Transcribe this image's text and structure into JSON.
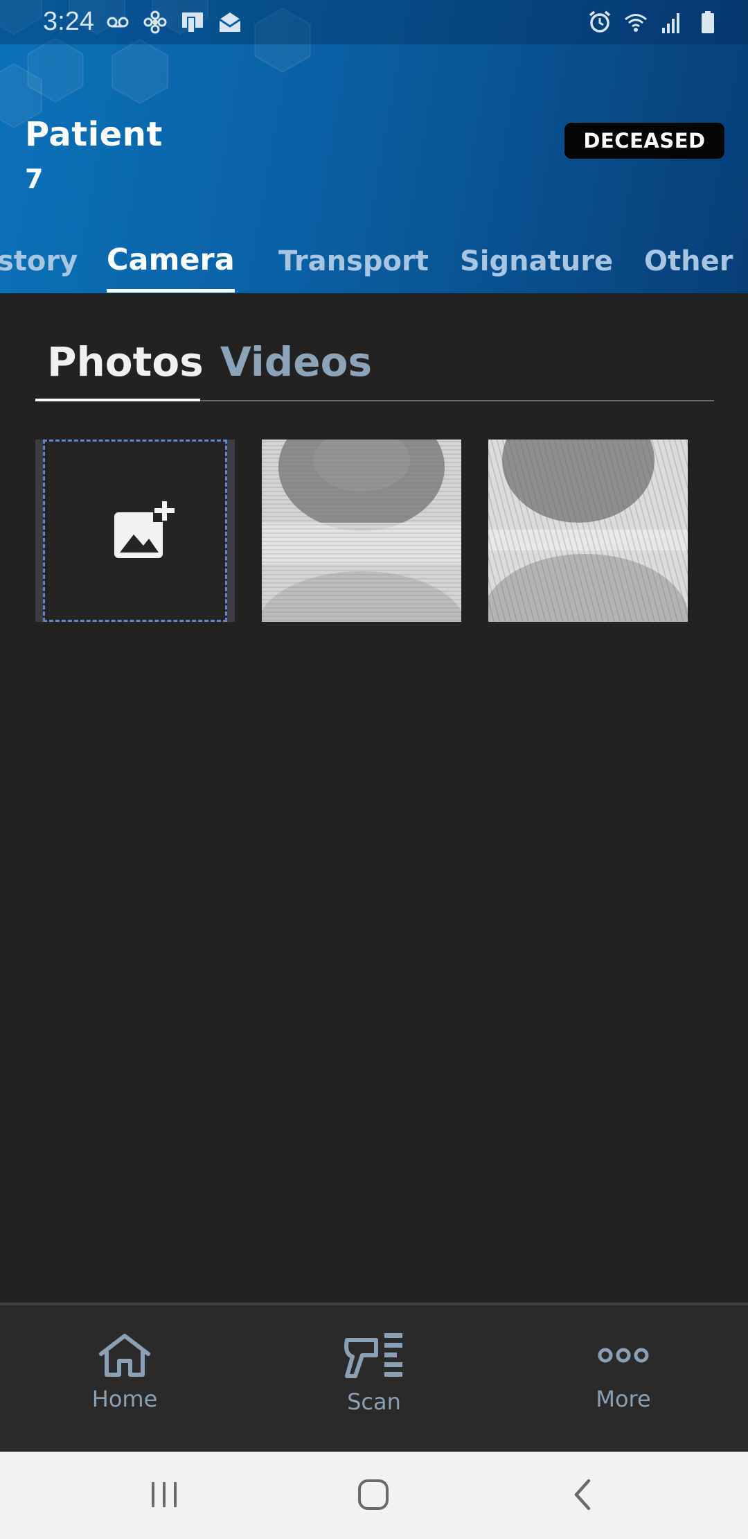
{
  "status_bar": {
    "time": "3:24"
  },
  "header": {
    "title": "Patient",
    "patient_id": "7",
    "status_badge": "DECEASED"
  },
  "tabs": [
    {
      "label": "story",
      "active": false
    },
    {
      "label": "Camera",
      "active": true
    },
    {
      "label": "Transport",
      "active": false
    },
    {
      "label": "Signature",
      "active": false
    },
    {
      "label": "Other",
      "active": false
    }
  ],
  "media_tabs": {
    "photos": "Photos",
    "videos": "Videos",
    "active": "Photos"
  },
  "gallery": {
    "add_icon": "add-photo-icon",
    "photo_count": 2
  },
  "bottom_nav": {
    "home": "Home",
    "scan": "Scan",
    "more": "More"
  },
  "colors": {
    "header_blue": "#0b72b8",
    "accent_dash": "#5f86c6",
    "background": "#222222",
    "inactive_tab": "#a8c6e2"
  }
}
